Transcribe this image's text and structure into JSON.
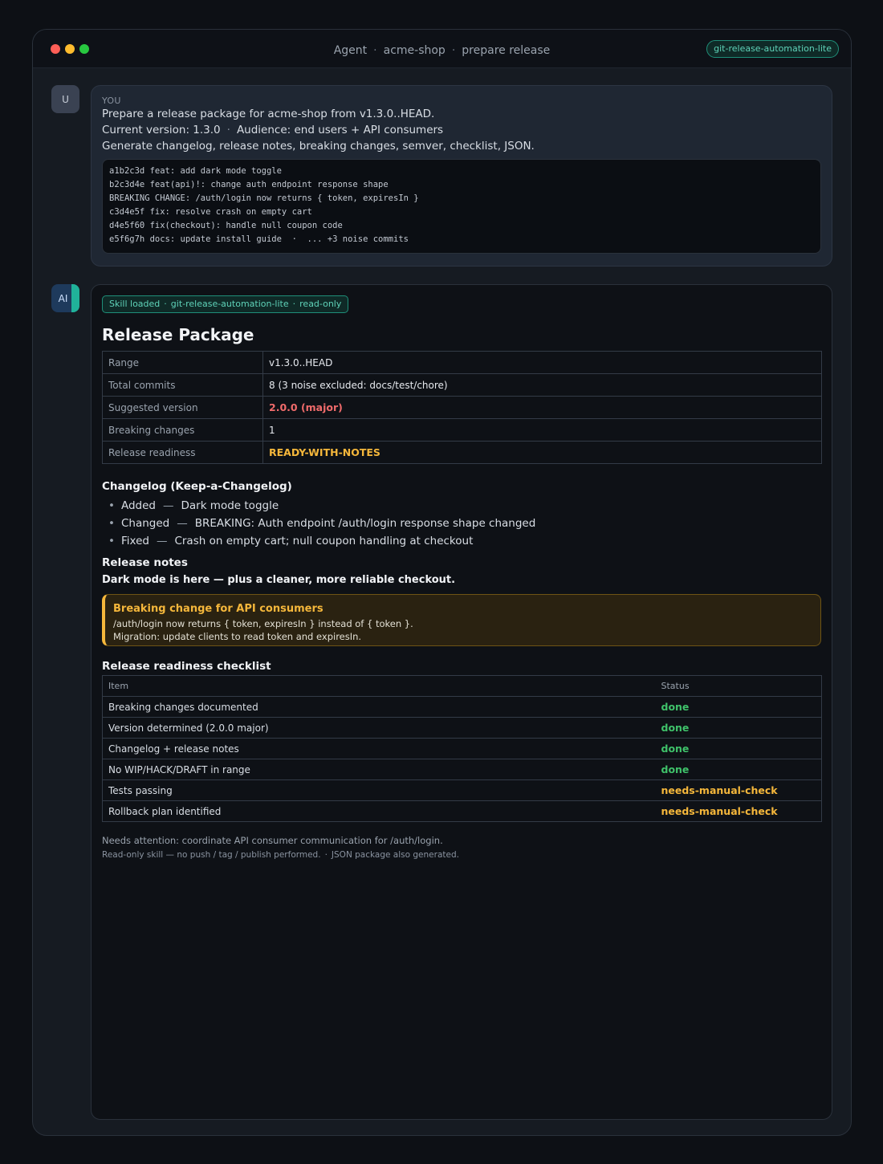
{
  "titlebar": {
    "crumbs": [
      "Agent",
      "acme-shop",
      "prepare release"
    ],
    "separator": "·",
    "skill_badge": "git-release-automation-lite"
  },
  "user_message": {
    "avatar": "U",
    "role_label": "YOU",
    "lines": [
      "Prepare a release package for acme-shop from v1.3.0..HEAD.",
      "Generate changelog, release notes, breaking changes, semver, checklist, JSON."
    ],
    "line2_parts": [
      "Current version: 1.3.0",
      "Audience: end users + API consumers"
    ],
    "commits": [
      "a1b2c3d feat: add dark mode toggle",
      "b2c3d4e feat(api)!: change auth endpoint response shape",
      "BREAKING CHANGE: /auth/login now returns { token, expiresIn }",
      "c3d4e5f fix: resolve crash on empty cart",
      "d4e5f60 fix(checkout): handle null coupon code",
      "e5f6g7h docs: update install guide  ·  ... +3 noise commits"
    ]
  },
  "ai_message": {
    "avatar": "AI",
    "skill_pill": [
      "Skill loaded",
      "git-release-automation-lite",
      "read-only"
    ],
    "heading": "Release Package",
    "summary": {
      "range_label": "Range",
      "range_value": "v1.3.0..HEAD",
      "commits_label": "Total commits",
      "commits_value": "8  (3 noise excluded: docs/test/chore)",
      "version_label": "Suggested version",
      "version_value": "2.0.0  (major)",
      "breaking_label": "Breaking changes",
      "breaking_value": "1",
      "readiness_label": "Release readiness",
      "readiness_value": "READY-WITH-NOTES"
    },
    "changelog_heading": "Changelog (Keep-a-Changelog)",
    "changelog": [
      {
        "type": "Added",
        "text": "Dark mode toggle"
      },
      {
        "type": "Changed",
        "text": "BREAKING: Auth endpoint /auth/login response shape changed"
      },
      {
        "type": "Fixed",
        "text": "Crash on empty cart; null coupon handling at checkout"
      }
    ],
    "notes_heading": "Release notes",
    "notes_tagline": "Dark mode is here — plus a cleaner, more reliable checkout.",
    "callout": {
      "title": "Breaking change for API consumers",
      "line1": "/auth/login now returns { token, expiresIn } instead of { token }.",
      "line2": "Migration: update clients to read token and expiresIn."
    },
    "checklist_heading": "Release readiness checklist",
    "checklist_columns": [
      "Item",
      "Status"
    ],
    "checklist": [
      {
        "item": "Breaking changes documented",
        "status": "done"
      },
      {
        "item": "Version determined (2.0.0 major)",
        "status": "done"
      },
      {
        "item": "Changelog + release notes",
        "status": "done"
      },
      {
        "item": "No WIP/HACK/DRAFT in range",
        "status": "done"
      },
      {
        "item": "Tests passing",
        "status": "needs-manual-check"
      },
      {
        "item": "Rollback plan identified",
        "status": "needs-manual-check"
      }
    ],
    "footnote_attention": "Needs attention: coordinate API consumer communication for /auth/login.",
    "footnote_parts": [
      "Read-only skill — no push / tag / publish performed.",
      "JSON package also generated."
    ]
  },
  "colors": {
    "accent_teal": "#5fd3b9",
    "status_done": "#3fc26a",
    "status_warn": "#f5b73b",
    "major_red": "#f06b6b"
  }
}
